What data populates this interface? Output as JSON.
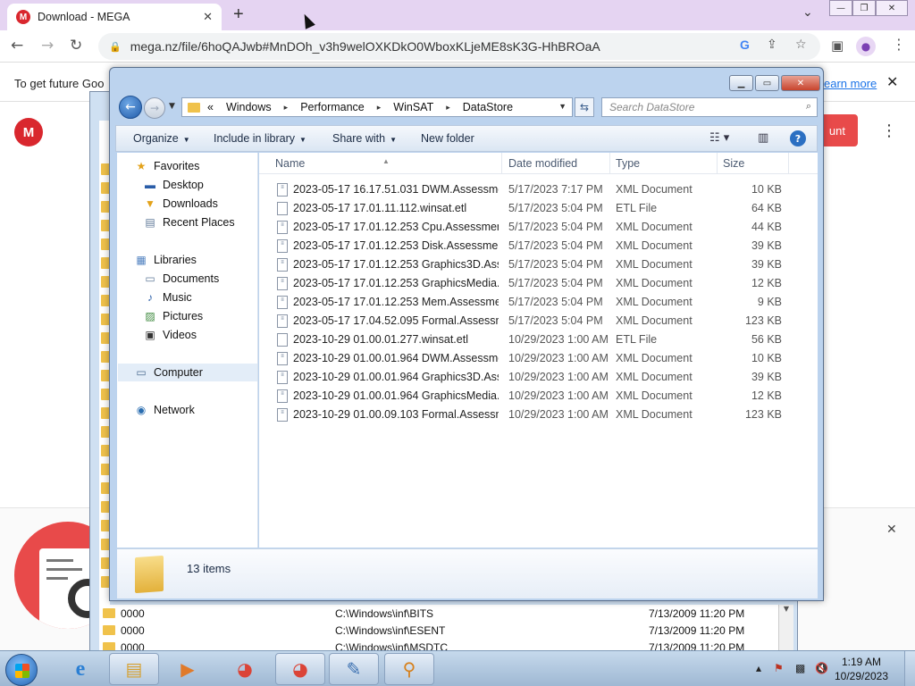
{
  "browser": {
    "tab_title": "Download - MEGA",
    "tab_close": "✕",
    "new_tab": "+",
    "url": "mega.nz/file/6hoQAJwb#MnDOh_v3h9welOXKDkO0WboxKLjeME8sK3G-HhBROaA"
  },
  "infobar": {
    "text": "To get future Goo",
    "learn_more": "earn more"
  },
  "mega": {
    "logo": "M",
    "button_label": "unt"
  },
  "bg_window": {
    "rows": [
      {
        "name": "0000",
        "path": "C:\\Windows\\inf\\BITS",
        "date": "7/13/2009 11:20 PM"
      },
      {
        "name": "0000",
        "path": "C:\\Windows\\inf\\ESENT",
        "date": "7/13/2009 11:20 PM"
      },
      {
        "name": "0000",
        "path": "C:\\Windows\\inf\\MSDTC",
        "date": "7/13/2009 11:20 PM"
      }
    ]
  },
  "explorer": {
    "breadcrumb": [
      "Windows",
      "Performance",
      "WinSAT",
      "DataStore"
    ],
    "breadcrumb_prefix": "«",
    "search_placeholder": "Search DataStore",
    "commands": {
      "organize": "Organize",
      "include_in_library": "Include in library",
      "share_with": "Share with",
      "new_folder": "New folder"
    },
    "nav": {
      "favorites": "Favorites",
      "desktop": "Desktop",
      "downloads": "Downloads",
      "recent_places": "Recent Places",
      "libraries": "Libraries",
      "documents": "Documents",
      "music": "Music",
      "pictures": "Pictures",
      "videos": "Videos",
      "computer": "Computer",
      "network": "Network"
    },
    "columns": {
      "name": "Name",
      "date_modified": "Date modified",
      "type": "Type",
      "size": "Size"
    },
    "files": [
      {
        "name": "2023-05-17 16.17.51.031 DWM.Assessme...",
        "date": "5/17/2023 7:17 PM",
        "type": "XML Document",
        "size": "10 KB",
        "icon": "xml"
      },
      {
        "name": "2023-05-17 17.01.11.112.winsat.etl",
        "date": "5/17/2023 5:04 PM",
        "type": "ETL File",
        "size": "64 KB",
        "icon": "etl"
      },
      {
        "name": "2023-05-17 17.01.12.253 Cpu.Assessment ...",
        "date": "5/17/2023 5:04 PM",
        "type": "XML Document",
        "size": "44 KB",
        "icon": "xml"
      },
      {
        "name": "2023-05-17 17.01.12.253 Disk.Assessment ...",
        "date": "5/17/2023 5:04 PM",
        "type": "XML Document",
        "size": "39 KB",
        "icon": "xml"
      },
      {
        "name": "2023-05-17 17.01.12.253 Graphics3D.Asse...",
        "date": "5/17/2023 5:04 PM",
        "type": "XML Document",
        "size": "39 KB",
        "icon": "xml"
      },
      {
        "name": "2023-05-17 17.01.12.253 GraphicsMedia.A...",
        "date": "5/17/2023 5:04 PM",
        "type": "XML Document",
        "size": "12 KB",
        "icon": "xml"
      },
      {
        "name": "2023-05-17 17.01.12.253 Mem.Assessmen...",
        "date": "5/17/2023 5:04 PM",
        "type": "XML Document",
        "size": "9 KB",
        "icon": "xml"
      },
      {
        "name": "2023-05-17 17.04.52.095 Formal.Assessm...",
        "date": "5/17/2023 5:04 PM",
        "type": "XML Document",
        "size": "123 KB",
        "icon": "xml"
      },
      {
        "name": "2023-10-29 01.00.01.277.winsat.etl",
        "date": "10/29/2023 1:00 AM",
        "type": "ETL File",
        "size": "56 KB",
        "icon": "etl"
      },
      {
        "name": "2023-10-29 01.00.01.964 DWM.Assessme...",
        "date": "10/29/2023 1:00 AM",
        "type": "XML Document",
        "size": "10 KB",
        "icon": "xml"
      },
      {
        "name": "2023-10-29 01.00.01.964 Graphics3D.Asse...",
        "date": "10/29/2023 1:00 AM",
        "type": "XML Document",
        "size": "39 KB",
        "icon": "xml"
      },
      {
        "name": "2023-10-29 01.00.01.964 GraphicsMedia.A...",
        "date": "10/29/2023 1:00 AM",
        "type": "XML Document",
        "size": "12 KB",
        "icon": "xml"
      },
      {
        "name": "2023-10-29 01.00.09.103 Formal.Assessm...",
        "date": "10/29/2023 1:00 AM",
        "type": "XML Document",
        "size": "123 KB",
        "icon": "xml"
      }
    ],
    "item_count": "13 items"
  },
  "taskbar": {
    "time": "1:19 AM",
    "date": "10/29/2023"
  }
}
